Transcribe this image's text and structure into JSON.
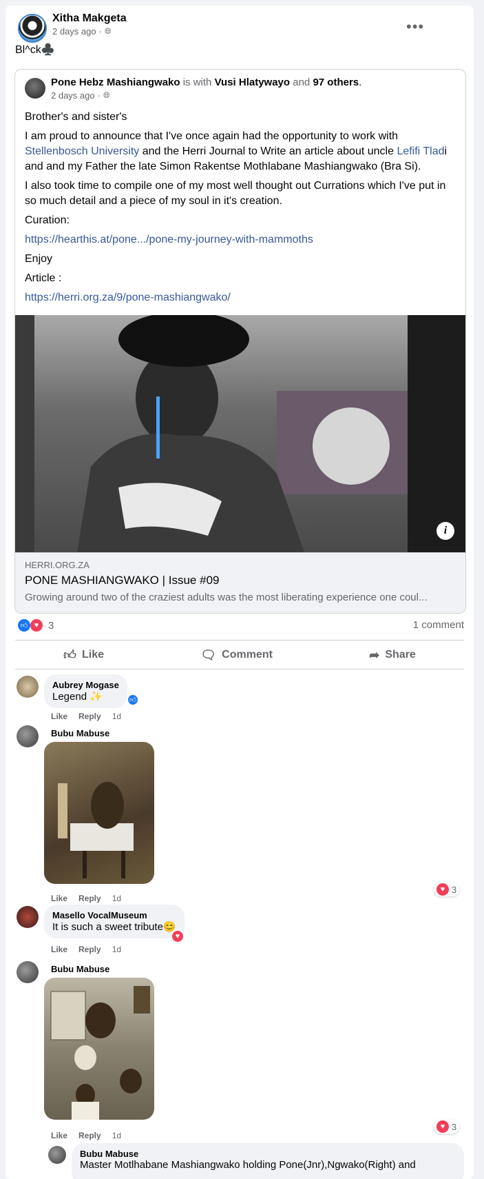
{
  "post": {
    "author": "Xitha Makgeta",
    "time": "2 days ago",
    "privacy_icon": "globe-icon",
    "text": "Bl^ck♣️",
    "more_icon": "more-icon"
  },
  "shared": {
    "author": "Pone Hebz Mashiangwako",
    "with_word": "is with",
    "with_person": "Vusi Hlatywayo",
    "and_word": "and",
    "others": "97 others",
    "time": "2 days ago",
    "p1": "Brother's and sister's",
    "p2a": "I am proud to announce that I've  once again had the opportunity to work with",
    "p2_link1": "Stellenbosch University",
    "p2b": "and the Herri Journal to Write an article about uncle",
    "p2_link2": "Lefifi Tlad",
    "p2c": "i",
    "p2d": "and and my Father the late Simon Rakentse Mothlabane Mashiangwako (Bra Si).",
    "p3": "I also took time to compile one of my most well thought out Currations which  I've put in so much detail and a piece of my soul in it's creation.",
    "p4": "Curation:",
    "p5": "https://hearthis.at/pone.../pone-my-journey-with-mammoths",
    "p6": "Enjoy",
    "p7": "Article :",
    "p8": "https://herri.org.za/9/pone-mashiangwako/",
    "domain": "HERRI.ORG.ZA",
    "title": "PONE MASHIANGWAKO | Issue #09",
    "desc": "Growing around two of the craziest adults was the most liberating experience one coul..."
  },
  "reactions": {
    "count": "3",
    "comments": "1 comment"
  },
  "actions": {
    "like": "Like",
    "comment": "Comment",
    "share": "Share"
  },
  "comments": [
    {
      "name": "Aubrey Mogase",
      "text": "Legend ✨",
      "like": "Like",
      "reply": "Reply",
      "time": "1d"
    },
    {
      "name": "Bubu Mabuse",
      "like": "Like",
      "reply": "Reply",
      "time": "1d",
      "reacts": "3"
    },
    {
      "name": "Masello VocalMuseum",
      "text": "It is such a sweet tribute😊",
      "like": "Like",
      "reply": "Reply",
      "time": "1d"
    },
    {
      "name": "Bubu Mabuse",
      "like": "Like",
      "reply": "Reply",
      "time": "1d",
      "reacts": "3"
    },
    {
      "name": "Bubu Mabuse",
      "text": "Master Motlhabane Mashiangwako holding Pone(Jnr),Ngwako(Right) and"
    }
  ]
}
